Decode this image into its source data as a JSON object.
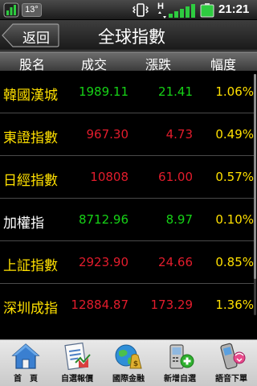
{
  "status_bar": {
    "temperature": "13°",
    "network_type": "H",
    "time": "21:21"
  },
  "title_bar": {
    "back_label": "返回",
    "title": "全球指數"
  },
  "columns": {
    "name": "股名",
    "volume": "成交",
    "change": "漲跌",
    "percent": "幅度"
  },
  "rows": [
    {
      "name": "韓國漢城",
      "value": "1989.11",
      "change": "21.41",
      "percent": "1.06%"
    },
    {
      "name": "東證指數",
      "value": "967.30",
      "change": "4.73",
      "percent": "0.49%"
    },
    {
      "name": "日經指數",
      "value": "10808",
      "change": "61.00",
      "percent": "0.57%"
    },
    {
      "name": "加權指",
      "value": "8712.96",
      "change": "8.97",
      "percent": "0.10%"
    },
    {
      "name": "上証指數",
      "value": "2923.90",
      "change": "24.66",
      "percent": "0.85%"
    },
    {
      "name": "深圳成指",
      "value": "12884.87",
      "change": "173.29",
      "percent": "1.36%"
    }
  ],
  "bottom_nav": [
    {
      "label": "首　頁",
      "icon": "home-icon"
    },
    {
      "label": "自選報價",
      "icon": "quote-list-icon"
    },
    {
      "label": "國際金融",
      "icon": "globe-money-icon"
    },
    {
      "label": "新增自選",
      "icon": "add-phone-icon"
    },
    {
      "label": "語音下單",
      "icon": "voice-order-icon"
    }
  ],
  "colors": {
    "up": "#16d216",
    "down": "#e21c2c",
    "highlight": "#ffe000"
  }
}
